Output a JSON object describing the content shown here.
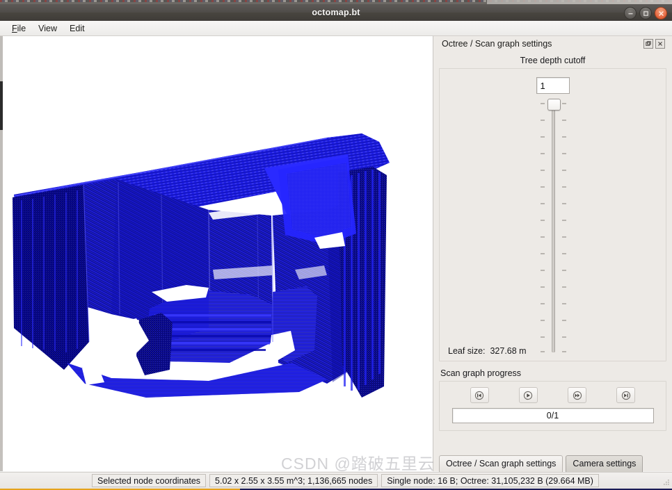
{
  "window": {
    "title": "octomap.bt",
    "controls": [
      {
        "name": "minimize",
        "glyph": "minimize-icon"
      },
      {
        "name": "maximize",
        "glyph": "maximize-icon"
      },
      {
        "name": "close",
        "glyph": "close-icon",
        "color": "#e8704a"
      }
    ]
  },
  "menubar": {
    "items": [
      {
        "label": "File",
        "accel": "F"
      },
      {
        "label": "View",
        "accel": ""
      },
      {
        "label": "Edit",
        "accel": ""
      }
    ]
  },
  "viewport": {
    "name": "octomap-3d-view",
    "background": "#ffffff",
    "point_color": "#1414d2",
    "point_color_light": "#2a2aff",
    "point_color_dark": "#00008c"
  },
  "dock": {
    "title": "Octree / Scan graph settings",
    "float_button": "float-icon",
    "close_button": "close-icon",
    "depth": {
      "section_title": "Tree depth cutoff",
      "value": "1",
      "slider_min": 1,
      "slider_max": 16,
      "slider_value": 1,
      "tick_count": 15,
      "leaf_size_label": "Leaf size:",
      "leaf_size_value": "327.68 m"
    },
    "progress": {
      "title": "Scan graph progress",
      "buttons": [
        {
          "name": "skip-to-start-button",
          "icon": "skip-backward-icon"
        },
        {
          "name": "play-button",
          "icon": "play-icon"
        },
        {
          "name": "step-forward-button",
          "icon": "fast-forward-icon"
        },
        {
          "name": "skip-to-end-button",
          "icon": "skip-forward-icon"
        }
      ],
      "bar_text": "0/1"
    },
    "tabs": [
      {
        "label": "Octree / Scan graph settings",
        "active": false
      },
      {
        "label": "Camera settings",
        "active": true
      }
    ]
  },
  "statusbar": {
    "cells": [
      {
        "name": "selected-node-coordinates",
        "text": "Selected node coordinates"
      },
      {
        "name": "octree-dimensions",
        "text": "5.02 x 2.55 x 3.55 m^3; 1,136,665 nodes"
      },
      {
        "name": "memory-usage",
        "text": "Single node: 16 B; Octree: 31,105,232 B (29.664 MB)"
      }
    ]
  },
  "watermark": {
    "text": "CSDN @踏破五里云"
  }
}
